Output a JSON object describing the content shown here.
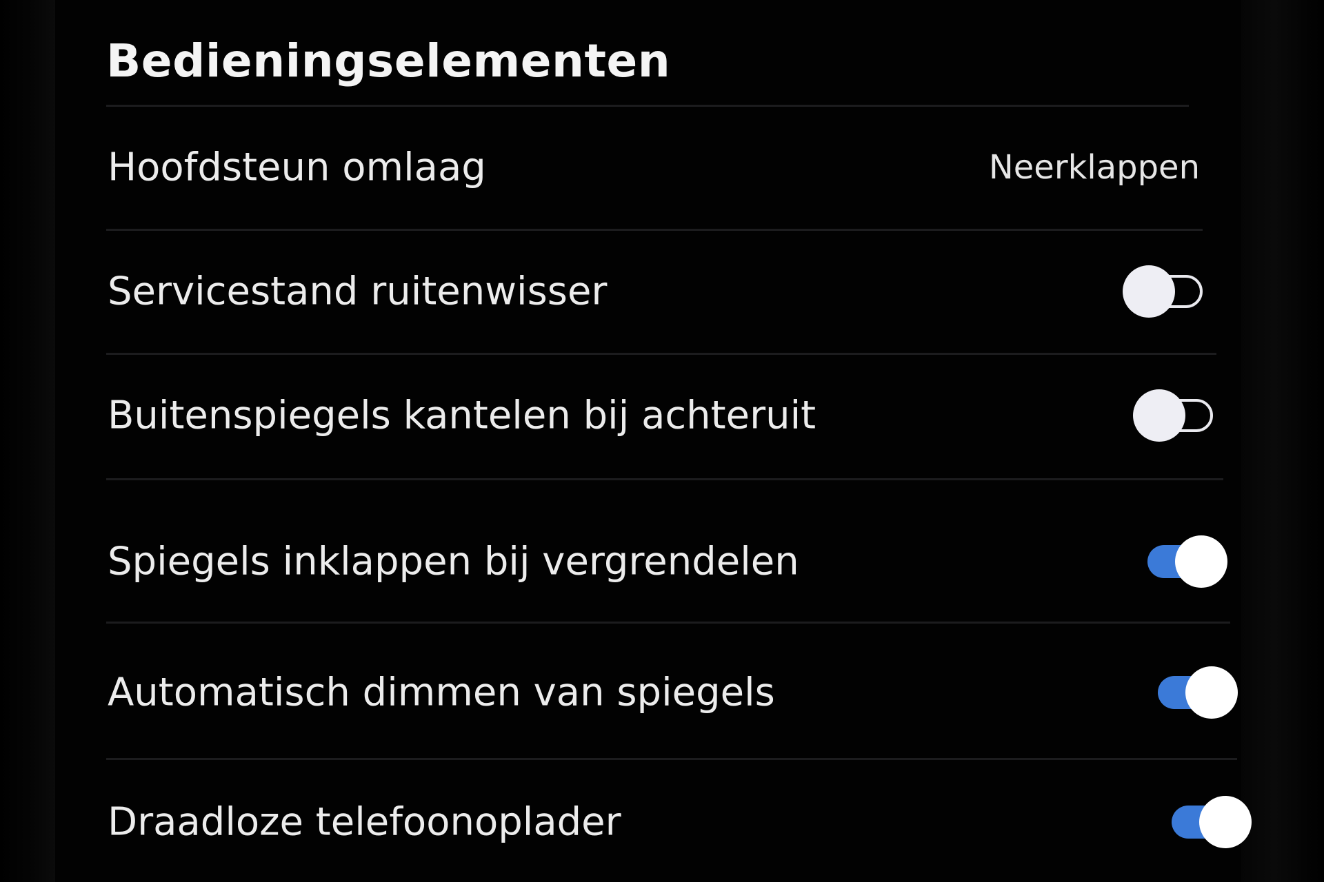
{
  "section": {
    "title": "Bedieningselementen"
  },
  "settings": [
    {
      "label": "Hoofdsteun omlaag",
      "value": "Neerklappen",
      "control": "value"
    },
    {
      "label": "Servicestand ruitenwisser",
      "control": "toggle",
      "state": "off"
    },
    {
      "label": "Buitenspiegels kantelen bij achteruit",
      "control": "toggle",
      "state": "off"
    },
    {
      "label": "Spiegels inklappen bij vergrendelen",
      "control": "toggle",
      "state": "on"
    },
    {
      "label": "Automatisch dimmen van spiegels",
      "control": "toggle",
      "state": "on"
    },
    {
      "label": "Draadloze telefoonoplader",
      "control": "toggle",
      "state": "on"
    }
  ],
  "colors": {
    "background": "#020202",
    "text": "#ececec",
    "toggle_on_track": "#3b7ad8",
    "toggle_knob": "#ffffff",
    "divider": "#1c1c1e"
  }
}
